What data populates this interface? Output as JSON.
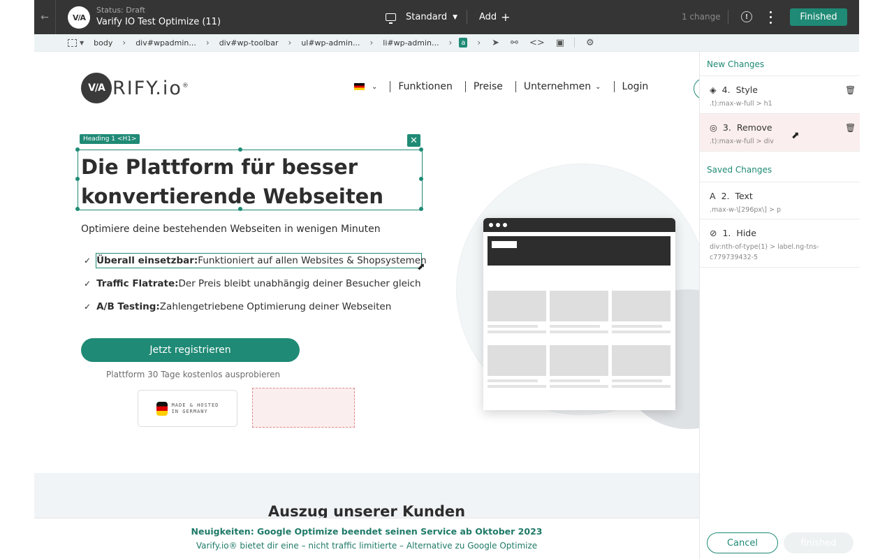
{
  "topbar": {
    "status": "Status: Draft",
    "title": "Varify IO Test Optimize (11)",
    "logo_text": "V/A",
    "device": "Standard",
    "add": "Add",
    "changes": "1 change",
    "finished": "Finished"
  },
  "breadcrumb": {
    "items": [
      "body",
      "div#wpadmin...",
      "div#wp-toolbar",
      "ul#wp-admin...",
      "li#wp-admin..."
    ],
    "current": "a"
  },
  "site": {
    "logo_mark": "V/A",
    "logo_word": "RIFY.io",
    "logo_reg": "®",
    "nav": [
      "Funktionen",
      "Preise",
      "Unternehmen",
      "Login"
    ],
    "selection_badge": "Heading 1 <H1>",
    "hero_title": "Die Plattform für besser konvertierende Webseiten",
    "hero_sub": "Optimiere deine bestehenden Webseiten in wenigen Minuten",
    "features": [
      {
        "bold": "Überall einsetzbar:",
        "text": " Funktioniert auf allen Websites & Shopsystemen"
      },
      {
        "bold": "Traffic Flatrate:",
        "text": " Der Preis bleibt unabhängig deiner Besucher gleich"
      },
      {
        "bold": "A/B Testing:",
        "text": " Zahlengetriebene Optimierung deiner Webseiten"
      }
    ],
    "cta": "Jetzt registrieren",
    "cta_note": "Plattform 30 Tage kostenlos ausprobieren",
    "trust_line1": "MADE & HOSTED",
    "trust_line2": "IN GERMANY",
    "clients_title": "Auszug unserer Kunden"
  },
  "news": {
    "title": "Neuigkeiten: Google Optimize beendet seinen Service ab Oktober 2023",
    "text": "Varify.io® bietet dir eine – nicht traffic limitierte – Alternative zu Google Optimize"
  },
  "panel": {
    "new_header": "New Changes",
    "saved_header": "Saved Changes",
    "new_changes": [
      {
        "number": "4.",
        "type": "Style",
        "selector": ".t):max-w-full > h1",
        "icon": "paint-bucket-icon"
      },
      {
        "number": "3.",
        "type": "Remove",
        "selector": ".t):max-w-full > div",
        "icon": "eye-remove-icon"
      }
    ],
    "saved_changes": [
      {
        "number": "2.",
        "type": "Text",
        "selector": ".max-w-\\[296px\\] > p",
        "icon": "text-icon"
      },
      {
        "number": "1.",
        "type": "Hide",
        "selector": "div:nth-of-type(1) > label.ng-tns-c779739432-5",
        "icon": "eye-off-icon"
      }
    ],
    "cancel": "Cancel",
    "finished": "finished"
  },
  "colors": {
    "accent": "#1f8a75",
    "topbar": "#353535",
    "removed_bg": "#fbeeee"
  }
}
